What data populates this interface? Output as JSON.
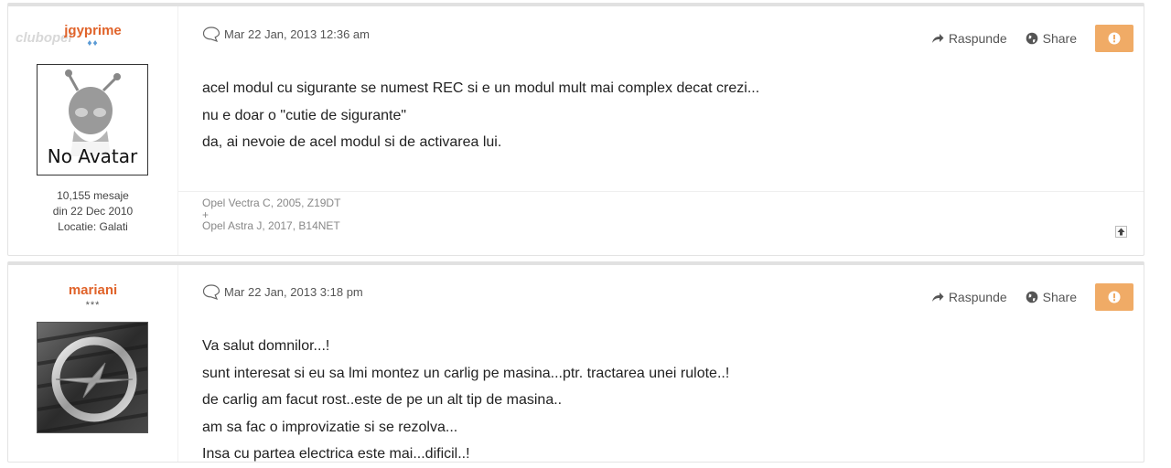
{
  "posts": [
    {
      "username": "jgyprime",
      "rank": "♦♦",
      "watermark": "clubopel",
      "avatar_label": "No Avatar",
      "stats": [
        "10,155 mesaje",
        "din 22 Dec 2010",
        "Locatie: Galati"
      ],
      "date": "Mar 22 Jan, 2013 12:36 am",
      "reply_label": "Raspunde",
      "share_label": "Share",
      "content": [
        "acel modul cu sigurante se numest REC si e un modul mult mai complex decat crezi...",
        "nu e doar o \"cutie de sigurante\"",
        "da, ai nevoie de acel modul si de activarea lui."
      ],
      "signature": [
        "Opel Vectra C, 2005, Z19DT",
        "+",
        "Opel Astra J, 2017, B14NET"
      ]
    },
    {
      "username": "mariani",
      "rank": "***",
      "date": "Mar 22 Jan, 2013 3:18 pm",
      "reply_label": "Raspunde",
      "share_label": "Share",
      "content": [
        "Va salut domnilor...!",
        "sunt interesat si eu sa lmi montez un carlig pe masina...ptr. tractarea unei rulote..!",
        "de carlig am facut rost..este de pe un alt tip de masina..",
        "am sa fac o improvizatie si se rezolva...",
        "Insa cu partea electrica este mai...dificil..!"
      ]
    }
  ],
  "colors": {
    "username": "#e0632a",
    "report": "#f0ab66"
  }
}
